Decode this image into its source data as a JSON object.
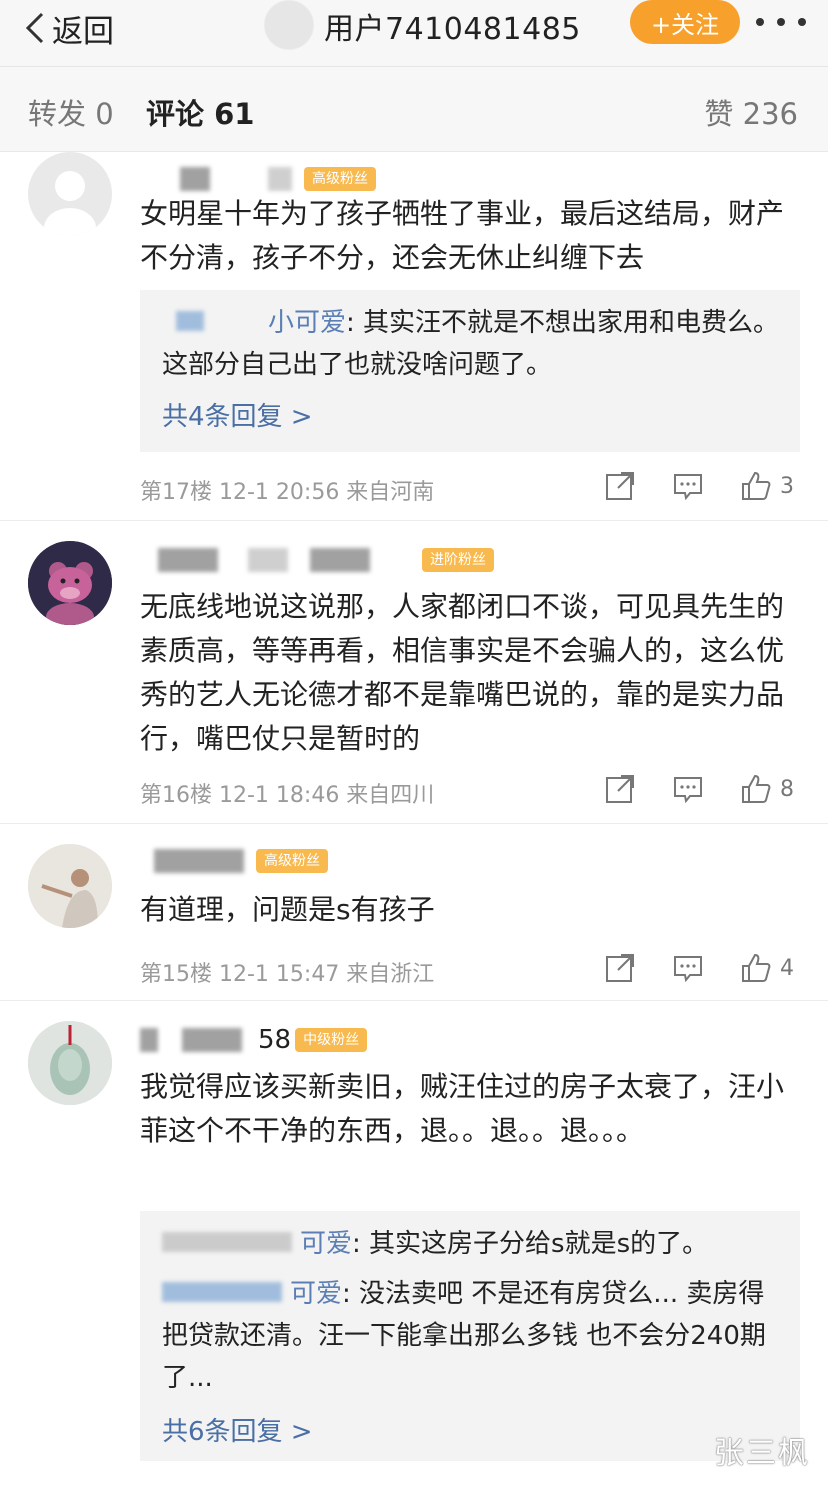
{
  "header": {
    "back_label": "返回",
    "title": "用户7410481485",
    "follow_label": "+关注",
    "colors": {
      "follow": "#f7a02b",
      "bar": "#f7f7f7"
    }
  },
  "tabs": {
    "repost": "转发 0",
    "comment": "评论 61",
    "like": "赞 236"
  },
  "comments": [
    {
      "badge": "高级粉丝",
      "text": "女明星十年为了孩子牺牲了事业，最后这结局，财产不分清，孩子不分，还会无休止纠缠下去",
      "replies": [
        {
          "name": "小可爱",
          "text": ": 其实汪不就是不想出家用和电费么。 这部分自己出了也就没啥问题了。"
        }
      ],
      "more_replies": "共4条回复 >",
      "meta": "第17楼 12-1 20:56 来自河南",
      "likes": "3"
    },
    {
      "badge": "进阶粉丝",
      "text": "无底线地说这说那，人家都闭口不谈，可见具先生的素质高，等等再看，相信事实是不会骗人的，这么优秀的艺人无论德才都不是靠嘴巴说的，靠的是实力品行，嘴巴仗只是暂时的",
      "meta": "第16楼 12-1 18:46 来自四川",
      "likes": "8"
    },
    {
      "badge": "高级粉丝",
      "text": "有道理，问题是s有孩子",
      "meta": "第15楼 12-1 15:47 来自浙江",
      "likes": "4"
    },
    {
      "name_suffix": "58",
      "badge": "中级粉丝",
      "text": "我觉得应该买新卖旧，贼汪住过的房子太衰了，汪小菲这个不干净的东西，退。。退。。退。。。",
      "replies": [
        {
          "name": "可爱",
          "text": ": 其实这房子分给s就是s的了。"
        },
        {
          "name": "可爱",
          "text": ": 没法卖吧 不是还有房贷么... 卖房得把贷款还清。汪一下能拿出那么多钱 也不会分240期了..."
        }
      ],
      "more_replies": "共6条回复 >"
    }
  ],
  "watermark": "张三枫"
}
